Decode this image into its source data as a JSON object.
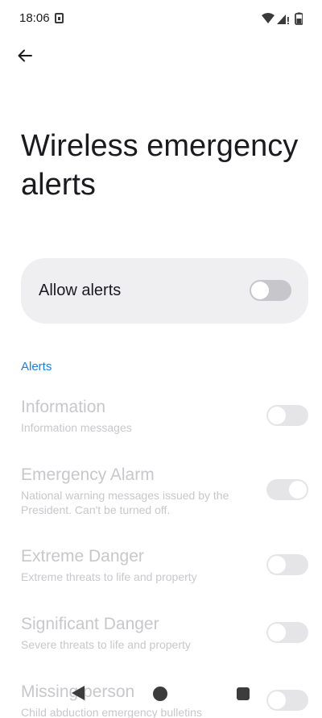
{
  "status_bar": {
    "time": "18:06",
    "icons": [
      "sim-icon",
      "wifi-icon",
      "signal-icon",
      "battery-icon"
    ]
  },
  "header": {
    "back_icon": "arrow-back-icon",
    "title": "Wireless emergency alerts"
  },
  "main_toggle": {
    "label": "Allow alerts",
    "enabled": false
  },
  "section": {
    "label": "Alerts",
    "color": "#1a7fe0"
  },
  "alerts": [
    {
      "title": "Information",
      "summary": "Information messages",
      "enabled": false
    },
    {
      "title": "Emergency Alarm",
      "summary": "National warning messages issued by the President. Can't be turned off.",
      "enabled": true
    },
    {
      "title": "Extreme Danger",
      "summary": "Extreme threats to life and property",
      "enabled": false
    },
    {
      "title": "Significant Danger",
      "summary": "Severe threats to life and property",
      "enabled": false
    },
    {
      "title": "Missing person",
      "summary": "Child abduction emergency bulletins",
      "enabled": false
    }
  ],
  "nav_bar": {
    "icons": [
      "nav-back-icon",
      "nav-home-icon",
      "nav-recents-icon"
    ]
  }
}
